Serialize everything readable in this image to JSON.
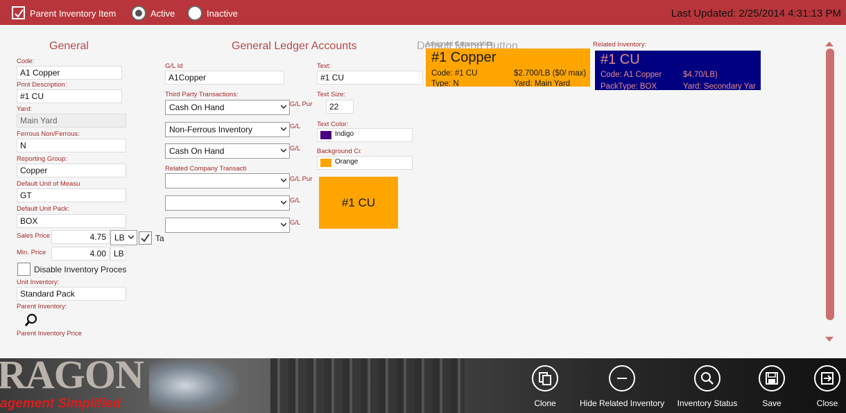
{
  "topbar": {
    "parent_inventory_label": "Parent Inventory Item",
    "active_label": "Active",
    "inactive_label": "Inactive",
    "last_updated": "Last Updated: 2/25/2014 4:31:13 PM"
  },
  "general": {
    "title": "General",
    "code_label": "Code:",
    "code_value": "A1 Copper",
    "print_desc_label": "Print Description:",
    "print_desc_value": "#1 CU",
    "yard_label": "Yard:",
    "yard_value": "Main Yard",
    "ferrous_label": "Ferrous Non/Ferrous:",
    "ferrous_value": "N",
    "reporting_label": "Reporting Group:",
    "reporting_value": "Copper",
    "uom_label": "Default Unit of Measu",
    "uom_value": "GT",
    "unit_pack_label": "Default Unit Pack:",
    "unit_pack_value": "BOX",
    "sales_price_label": "Sales Price",
    "sales_price_value": "4.75",
    "sales_unit": "LB",
    "taxable_label": "Ta",
    "min_price_label": "Min. Price",
    "min_price_value": "4.00",
    "min_unit": "LB",
    "disable_label": "Disable Inventory Process",
    "unit_inventory_label": "Unit Inventory:",
    "unit_inventory_value": "Standard Pack",
    "parent_inventory_label": "Parent Inventory:",
    "parent_price_label": "Parent Inventory Price"
  },
  "gl": {
    "title": "General Ledger Accounts",
    "gl_id_label": "G/L Id",
    "gl_id_value": "A1Copper",
    "third_party_label": "Third Party Transactions:",
    "tp1": "Cash On Hand",
    "tp2": "Non-Ferrous Inventory",
    "tp3": "Cash On Hand",
    "side1": "G/L Pur",
    "side2": "G/L",
    "side3": "G/L",
    "related_label": "Related Company Transacti",
    "rside1": "G/L Pur",
    "rside2": "G/L",
    "rside3": "G/L"
  },
  "button": {
    "title": "Default Menu Button",
    "text_label": "Text:",
    "text_value": "#1 CU",
    "size_label": "Text Size:",
    "size_value": "22",
    "color_label": "Text Color:",
    "color_value": "Indigo",
    "color_hex": "#4b0082",
    "bg_label": "Background Colo",
    "bg_value": "Orange",
    "bg_hex": "#ffa500",
    "preview_text": "#1 CU"
  },
  "assigned": {
    "label": "Assigned Commodities:",
    "title": "#1 Copper",
    "code": "Code: #1 CU",
    "price": "$2.700/LB ($0/ max)",
    "type": "Type: N",
    "yard": "Yard: Main Yard"
  },
  "related": {
    "label": "Related Inventory:",
    "title": "#1 CU",
    "code": "Code: A1 Copper",
    "price": "$4.70/LB)",
    "pack": "PackType: BOX",
    "yard": "Yard: Secondary Yar"
  },
  "appbar": {
    "brand_line1": "RAGON",
    "brand_line2": "agement Simplified",
    "clone": "Clone",
    "hide_related": "Hide Related Inventory",
    "inv_status": "Inventory Status",
    "save": "Save",
    "close": "Close"
  }
}
